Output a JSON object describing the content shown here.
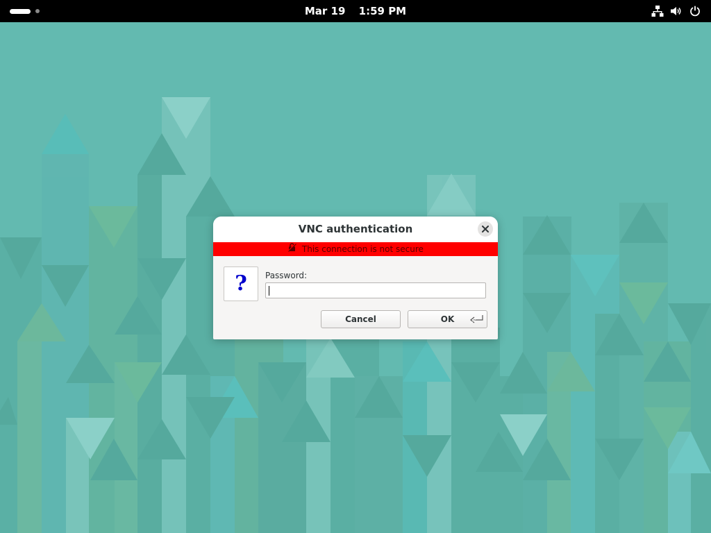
{
  "topbar": {
    "date": "Mar 19",
    "time": "1:59 PM",
    "icons": [
      "network-icon",
      "volume-icon",
      "power-icon"
    ]
  },
  "dialog": {
    "title": "VNC authentication",
    "warning": "This connection is not secure",
    "question_glyph": "?",
    "password_label": "Password:",
    "password_value": "",
    "cancel_label": "Cancel",
    "ok_label": "OK"
  },
  "colors": {
    "desktop": "#63bab0",
    "warning_bar": "#ff0000",
    "topbar": "#000000"
  }
}
